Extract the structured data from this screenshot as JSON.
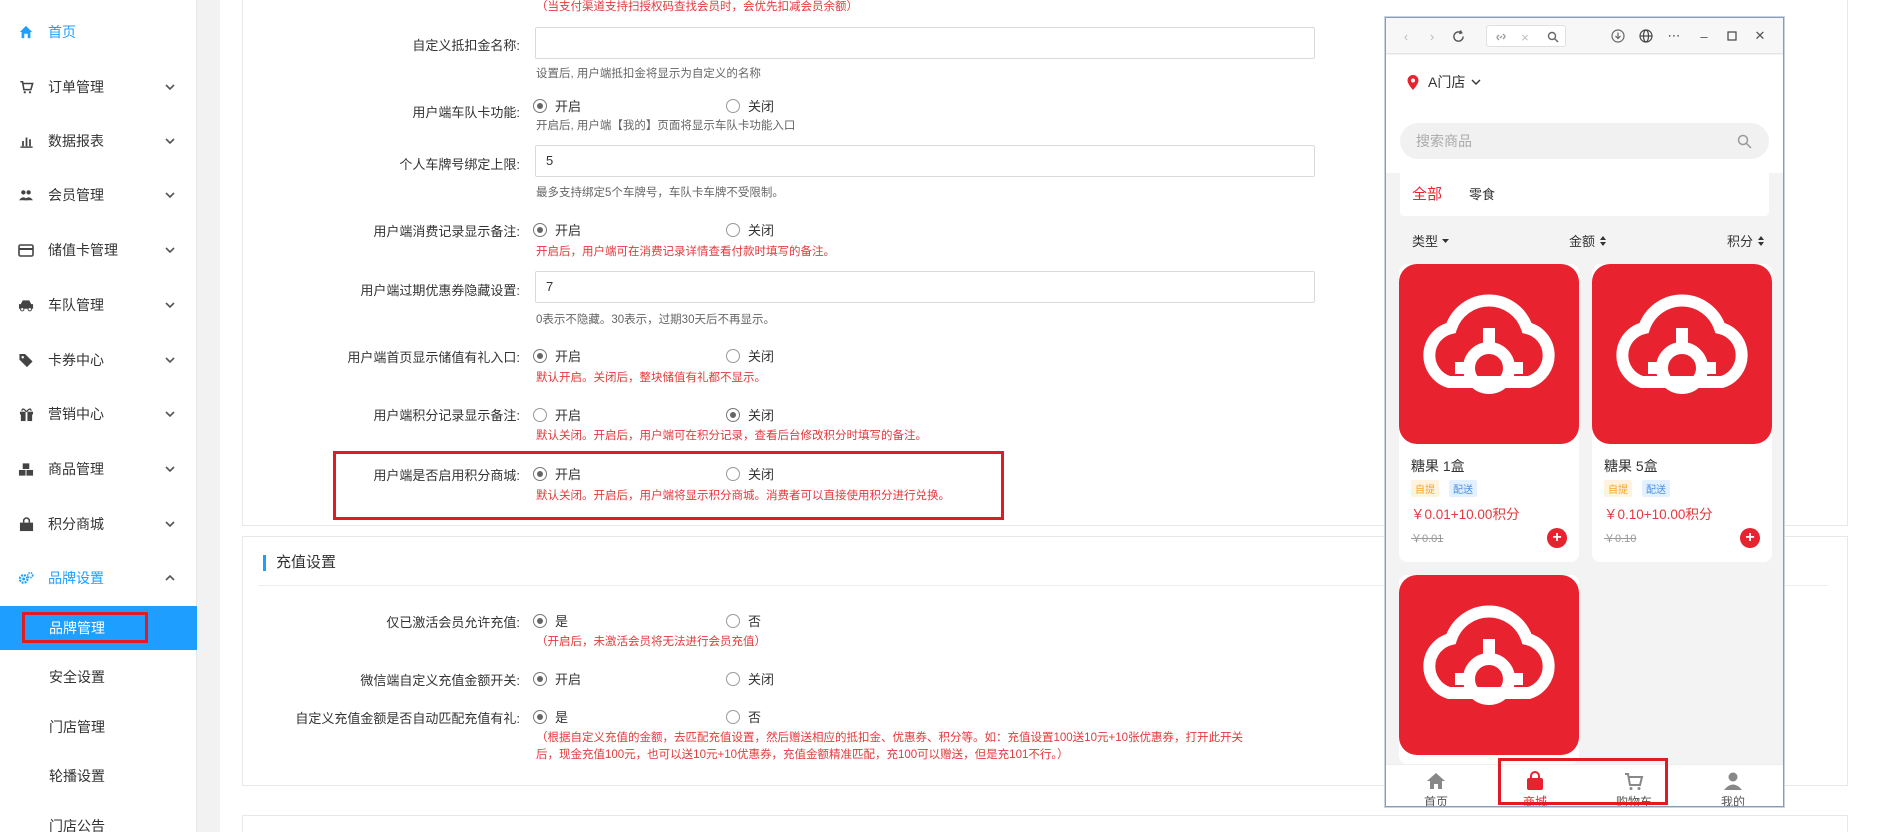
{
  "sidebar": {
    "items": [
      {
        "label": "首页",
        "icon": "home-icon"
      },
      {
        "label": "订单管理",
        "icon": "cart-icon"
      },
      {
        "label": "数据报表",
        "icon": "bar-chart-icon"
      },
      {
        "label": "会员管理",
        "icon": "users-icon"
      },
      {
        "label": "储值卡管理",
        "icon": "credit-card-icon"
      },
      {
        "label": "车队管理",
        "icon": "car-icon"
      },
      {
        "label": "卡券中心",
        "icon": "tags-icon"
      },
      {
        "label": "营销中心",
        "icon": "gift-icon"
      },
      {
        "label": "商品管理",
        "icon": "cubes-icon"
      },
      {
        "label": "积分商城",
        "icon": "shopping-bag-icon"
      },
      {
        "label": "品牌设置",
        "icon": "gears-icon"
      }
    ],
    "sub_items": [
      {
        "label": "品牌管理"
      },
      {
        "label": "安全设置"
      },
      {
        "label": "门店管理"
      },
      {
        "label": "轮播设置"
      },
      {
        "label": "门店公告"
      }
    ]
  },
  "form": {
    "top_note": "（当支付渠道支持扫授权码查找会员时，会优先扣减会员余额）",
    "rows": {
      "deduction_name": {
        "label": "自定义抵扣金名称:",
        "value": "",
        "hint": "设置后, 用户端抵扣金将显示为自定义的名称"
      },
      "fleet_card": {
        "label": "用户端车队卡功能:",
        "opt_on": "开启",
        "opt_off": "关闭",
        "hint": "开启后, 用户端【我的】页面将显示车队卡功能入口"
      },
      "plate_limit": {
        "label": "个人车牌号绑定上限:",
        "value": "5",
        "hint": "最多支持绑定5个车牌号，车队卡车牌不受限制。"
      },
      "consume_note": {
        "label": "用户端消费记录显示备注:",
        "opt_on": "开启",
        "opt_off": "关闭",
        "hint": "开启后，用户端可在消费记录详情查看付款时填写的备注。"
      },
      "expired_coupon": {
        "label": "用户端过期优惠券隐藏设置:",
        "value": "7",
        "hint": "0表示不隐藏。30表示，过期30天后不再显示。"
      },
      "home_recharge": {
        "label": "用户端首页显示储值有礼入口:",
        "opt_on": "开启",
        "opt_off": "关闭",
        "hint": "默认开启。关闭后，整块储值有礼都不显示。"
      },
      "points_note": {
        "label": "用户端积分记录显示备注:",
        "opt_on": "开启",
        "opt_off": "关闭",
        "hint": "默认关闭。开启后，用户端可在积分记录，查看后台修改积分时填写的备注。"
      },
      "points_mall": {
        "label": "用户端是否启用积分商城:",
        "opt_on": "开启",
        "opt_off": "关闭",
        "hint": "默认关闭。开启后，用户端将显示积分商城。消费者可以直接使用积分进行兑换。"
      }
    },
    "recharge_section": {
      "title": "充值设置",
      "activated_only": {
        "label": "仅已激活会员允许充值:",
        "opt_yes": "是",
        "opt_no": "否",
        "hint": "（开启后，未激活会员将无法进行会员充值）"
      },
      "wechat_custom": {
        "label": "微信端自定义充值金额开关:",
        "opt_on": "开启",
        "opt_off": "关闭"
      },
      "auto_match": {
        "label": "自定义充值金额是否自动匹配充值有礼:",
        "opt_yes": "是",
        "opt_no": "否",
        "hint_line1": "（根据自定义充值的金额，去匹配充值设置，然后赠送相应的抵扣金、优惠券、积分等。如：充值设置100送10元+10张优惠券，打开此开关",
        "hint_line2": "后，现金充值100元，也可以送10元+10优惠券，充值金额精准匹配，充100可以赠送，但是充101不行。）"
      }
    }
  },
  "phone": {
    "store_name": "A门店",
    "search_placeholder": "搜索商品",
    "categories": [
      "全部",
      "零食"
    ],
    "filters": [
      "类型",
      "金额",
      "积分"
    ],
    "products": [
      {
        "name": "糖果 1盒",
        "tag_pick": "自提",
        "tag_deliver": "配送",
        "price": "￥0.01+10.00积分",
        "old_price": "￥0.01"
      },
      {
        "name": "糖果 5盒",
        "tag_pick": "自提",
        "tag_deliver": "配送",
        "price": "￥0.10+10.00积分",
        "old_price": "￥0.10"
      }
    ],
    "tabs": [
      {
        "label": "首页",
        "icon": "home-icon"
      },
      {
        "label": "商城",
        "icon": "shopping-bag-icon"
      },
      {
        "label": "购物车",
        "icon": "cart-icon"
      },
      {
        "label": "我的",
        "icon": "user-icon"
      }
    ]
  },
  "colors": {
    "accent": "#1e9fff",
    "brand_red": "#e8222e",
    "highlight": "#e01b24",
    "warning_text": "#e4393c"
  }
}
